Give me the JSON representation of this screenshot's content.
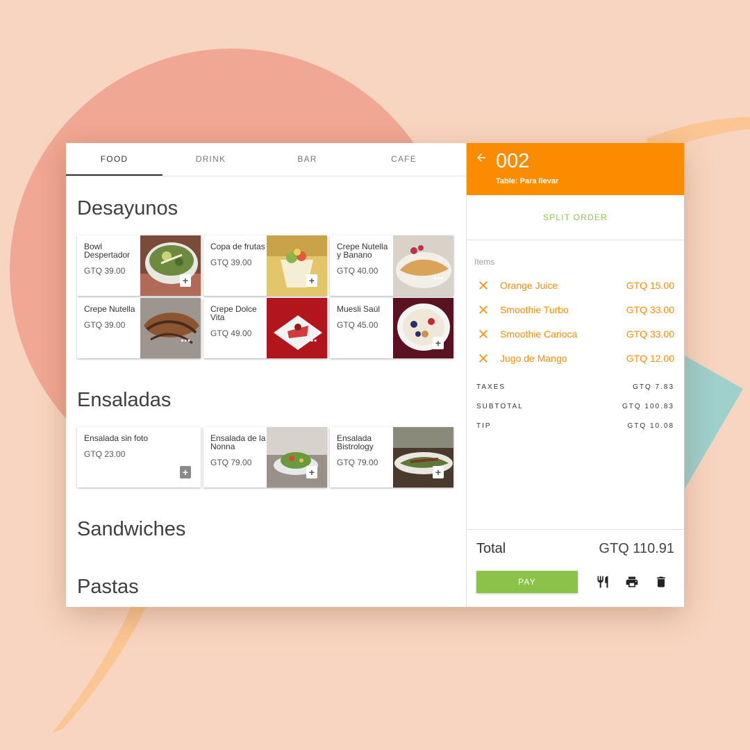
{
  "tabs": [
    "FOOD",
    "DRINK",
    "BAR",
    "CAFE"
  ],
  "sections": [
    {
      "title": "Desayunos",
      "items": [
        {
          "name": "Bowl Despertador",
          "price": "GTQ 39.00",
          "badge": "add"
        },
        {
          "name": "Copa de frutas",
          "price": "GTQ 39.00",
          "badge": "add"
        },
        {
          "name": "Crepe Nutella y Banano",
          "price": "GTQ 40.00",
          "badge": "more"
        },
        {
          "name": "Crepe Nutella",
          "price": "GTQ 39.00",
          "badge": "more"
        },
        {
          "name": "Crepe Dolce Vita",
          "price": "GTQ 49.00",
          "badge": "more"
        },
        {
          "name": "Muesli Saúl",
          "price": "GTQ 45.00",
          "badge": "add"
        }
      ]
    },
    {
      "title": "Ensaladas",
      "items": [
        {
          "name": "Ensalada sin foto",
          "price": "GTQ 23.00",
          "badge": "add"
        },
        {
          "name": "Ensalada de la Nonna",
          "price": "GTQ 79.00",
          "badge": "add"
        },
        {
          "name": "Ensalada Bistrology",
          "price": "GTQ 79.00",
          "badge": "add"
        }
      ]
    },
    {
      "title": "Sandwiches",
      "items": []
    },
    {
      "title": "Pastas",
      "items": []
    }
  ],
  "order": {
    "number": "002",
    "table": "Table: Para llevar",
    "split_label": "SPLIT ORDER",
    "items_label": "Items",
    "items": [
      {
        "name": "Orange Juice",
        "price": "GTQ 15.00"
      },
      {
        "name": "Smoothie Turbo",
        "price": "GTQ 33.00"
      },
      {
        "name": "Smoothie Carioca",
        "price": "GTQ 33.00"
      },
      {
        "name": "Jugo de Mango",
        "price": "GTQ 12.00"
      }
    ],
    "taxes_label": "TAXES",
    "taxes": "GTQ 7.83",
    "subtotal_label": "SUBTOTAL",
    "subtotal": "GTQ 100.83",
    "tip_label": "TIP",
    "tip": "GTQ 10.08",
    "total_label": "Total",
    "total": "GTQ 110.91",
    "pay_label": "PAY"
  },
  "colors": {
    "accent": "#fb8c00",
    "pay": "#8bc34a",
    "background": "#f8d5c0"
  }
}
